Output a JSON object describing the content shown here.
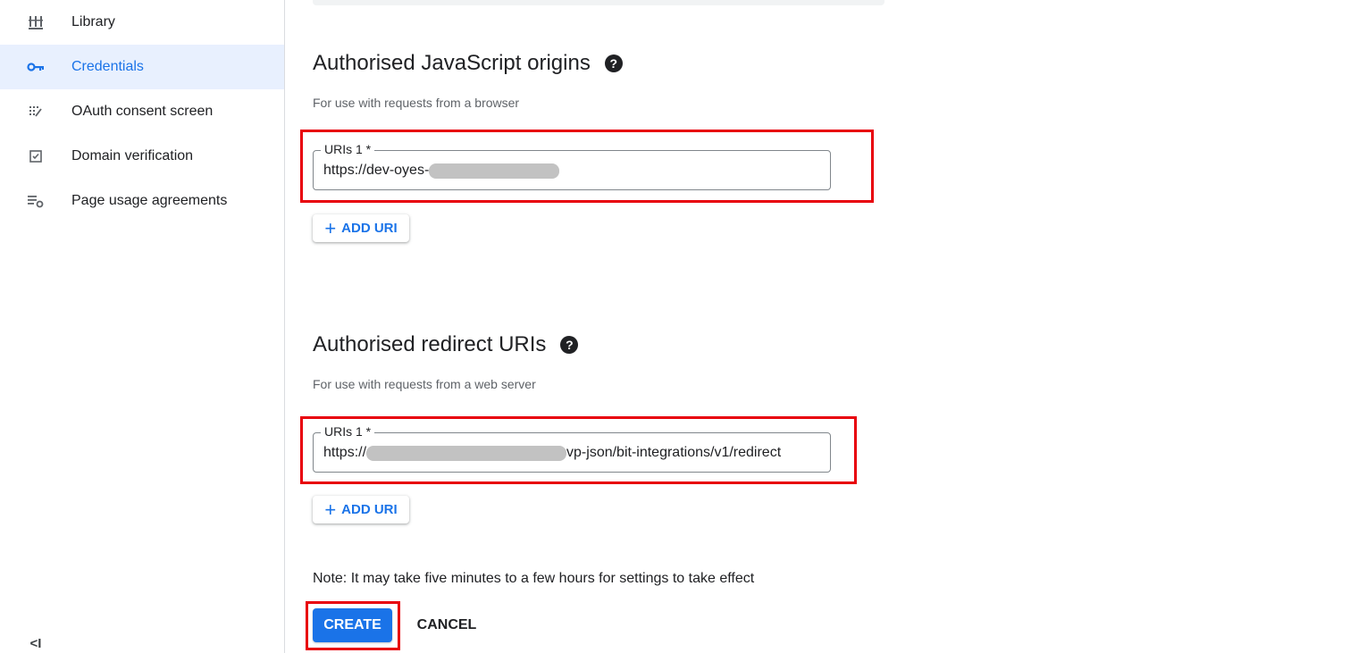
{
  "sidebar": {
    "items": [
      {
        "label": "Library",
        "icon": "library-icon"
      },
      {
        "label": "Credentials",
        "icon": "key-icon"
      },
      {
        "label": "OAuth consent screen",
        "icon": "consent-icon"
      },
      {
        "label": "Domain verification",
        "icon": "checkbox-icon"
      },
      {
        "label": "Page usage agreements",
        "icon": "settings-list-icon"
      }
    ],
    "active_index": 1,
    "collapse_label": "<I"
  },
  "js_origins": {
    "title": "Authorised JavaScript origins",
    "help": "?",
    "subtitle": "For use with requests from a browser",
    "field_label": "URIs 1 *",
    "field_value_prefix": "https://dev-oyes-",
    "field_value_suffix": "",
    "add_label": "ADD URI"
  },
  "redirect_uris": {
    "title": "Authorised redirect URIs",
    "help": "?",
    "subtitle": "For use with requests from a web server",
    "field_label": "URIs 1 *",
    "field_value_prefix": "https://",
    "field_value_suffix": "vp-json/bit-integrations/v1/redirect",
    "add_label": "ADD URI"
  },
  "note": "Note: It may take five minutes to a few hours for settings to take effect",
  "actions": {
    "create_label": "CREATE",
    "cancel_label": "CANCEL"
  },
  "colors": {
    "accent": "#1a73e8",
    "highlight": "#e8000b",
    "active_bg": "#e8f0fe"
  }
}
